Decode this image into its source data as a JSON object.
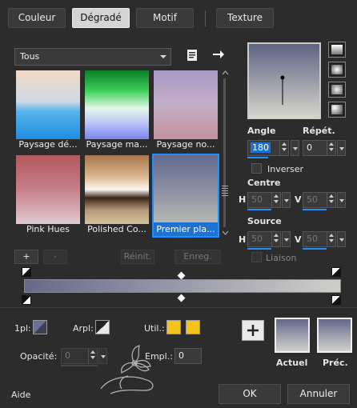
{
  "tabs": [
    {
      "label": "Couleur",
      "active": false
    },
    {
      "label": "Dégradé",
      "active": true
    },
    {
      "label": "Motif",
      "active": false
    },
    {
      "label": "Texture",
      "active": false
    }
  ],
  "category_select": {
    "value": "Tous"
  },
  "presets": [
    {
      "label": "Paysage dé...",
      "top": "#f2d9c4",
      "bottom": "#2f9be0"
    },
    {
      "label": "Paysage ma...",
      "top": "#10b13b",
      "bottom": "#8d8bf2"
    },
    {
      "label": "Paysage no...",
      "top": "#a99ac6",
      "bottom": "#c6939e"
    },
    {
      "label": "Pink Hues",
      "top": "#b2575f",
      "bottom": "#dcbfc4"
    },
    {
      "label": "Polished Co...",
      "top": "#a8764e",
      "bottom": "#ceb693"
    },
    {
      "label": "Premier pla...",
      "top": "#626a8c",
      "bottom": "#b6b7b3"
    }
  ],
  "angle": {
    "label": "Angle",
    "value": "180"
  },
  "repeat": {
    "label": "Répét.",
    "value": "0"
  },
  "invert": {
    "label": "Inverser"
  },
  "centre": {
    "label": "Centre",
    "h_label": "H",
    "h_value": "50",
    "v_label": "V",
    "v_value": "50"
  },
  "source": {
    "label": "Source",
    "h_label": "H",
    "h_value": "50",
    "v_label": "V",
    "v_value": "50"
  },
  "link": {
    "label": "Liaison"
  },
  "editor_buttons": {
    "add": "+",
    "remove": "-",
    "reset": "Réinit.",
    "save": "Enreg."
  },
  "stop_bar": {
    "left_color": "#656a8a",
    "right_color": "#d0cfca"
  },
  "pl": {
    "label": "1pl:"
  },
  "arpl": {
    "label": "Arpl:"
  },
  "util": {
    "label": "Util.:",
    "color": "#f3c31a"
  },
  "opacity": {
    "label": "Opacité:",
    "value": "0"
  },
  "empl": {
    "label": "Empl.:",
    "value": "0"
  },
  "swatches": {
    "actuel": "Actuel",
    "prec": "Préc."
  },
  "preview": {
    "top": "#5f6484",
    "bottom": "#d7d4cc"
  },
  "footer": {
    "help": "Aide",
    "ok": "OK",
    "cancel": "Annuler"
  }
}
